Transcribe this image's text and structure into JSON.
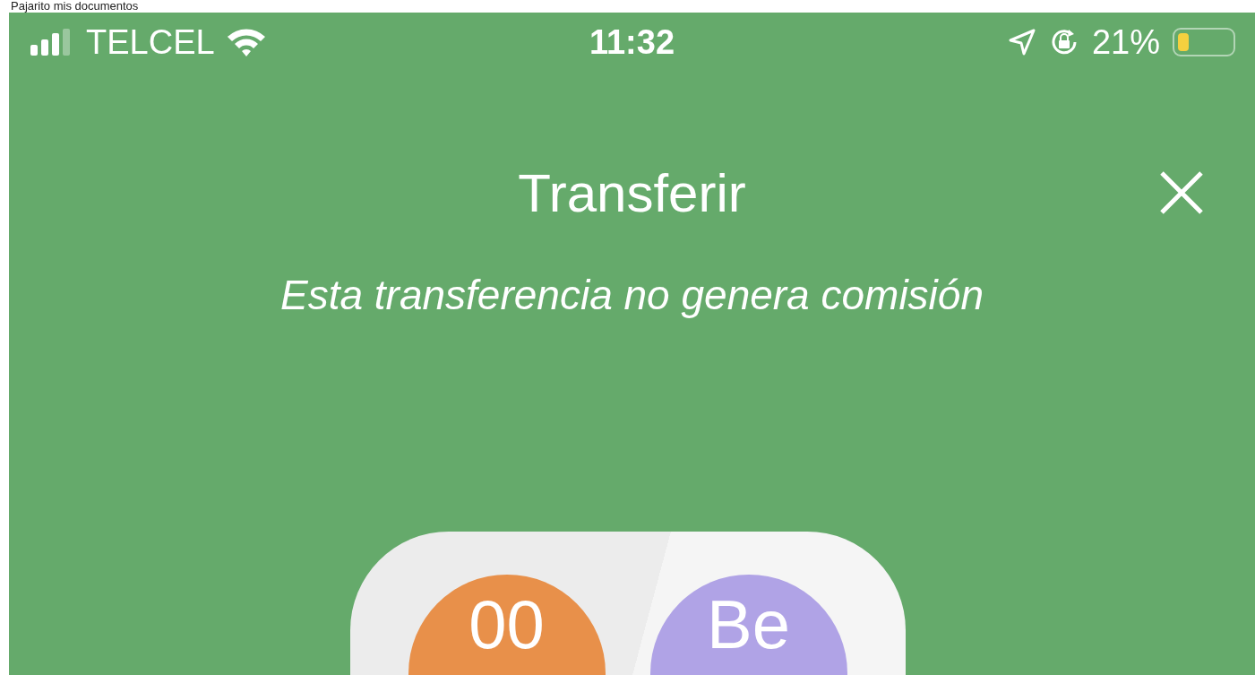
{
  "caption": "Pajarito mis documentos",
  "status_bar": {
    "carrier": "TELCEL",
    "time": "11:32",
    "battery": {
      "reading": "21%",
      "level": 0.21
    }
  },
  "header": {
    "title": "Transferir",
    "note": "Esta transferencia no genera comisión"
  },
  "accounts": [
    {
      "initials": "00",
      "color": "#e8904a"
    },
    {
      "initials": "Be",
      "color": "#b0a3e6"
    }
  ]
}
